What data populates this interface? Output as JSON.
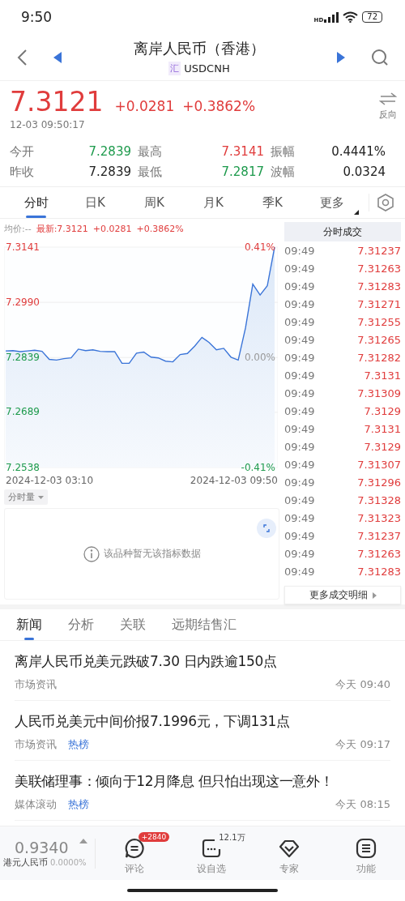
{
  "status_bar": {
    "time": "9:50",
    "battery": "72",
    "signal_tag": "HD"
  },
  "header": {
    "title": "离岸人民币（香港）",
    "badge": "汇",
    "code": "USDCNH"
  },
  "quote": {
    "price": "7.3121",
    "change": "+0.0281",
    "change_pct": "+0.3862%",
    "time": "12-03 09:50:17",
    "swap_label": "反向"
  },
  "stats": [
    {
      "label": "今开",
      "value": "7.2839",
      "color": "#1d9a4c"
    },
    {
      "label": "最高",
      "value": "7.3141",
      "color": "#e03c3c"
    },
    {
      "label": "振幅",
      "value": "0.4441%",
      "color": "#222222"
    },
    {
      "label": "昨收",
      "value": "7.2839",
      "color": "#222222"
    },
    {
      "label": "最低",
      "value": "7.2817",
      "color": "#1d9a4c"
    },
    {
      "label": "波幅",
      "value": "0.0324",
      "color": "#222222"
    }
  ],
  "chart_tabs": [
    {
      "label": "分时",
      "selected": true
    },
    {
      "label": "日K",
      "selected": false
    },
    {
      "label": "周K",
      "selected": false
    },
    {
      "label": "月K",
      "selected": false
    },
    {
      "label": "季K",
      "selected": false
    },
    {
      "label": "更多",
      "selected": false
    }
  ],
  "chart_header": {
    "avg": "均价:--",
    "latest": "最新:7.3121",
    "change": "+0.0281",
    "change_pct": "+0.3862%"
  },
  "chart": {
    "time_labels": [
      "2024-12-03 03:10",
      "2024-12-03 09:50"
    ],
    "percent_labels": [
      "0.41%",
      "0.00%",
      "-0.41%"
    ],
    "chart_data": {
      "type": "area",
      "grid": true,
      "ylim": [
        7.2538,
        7.3141
      ],
      "yticks": [
        {
          "value": 7.3141,
          "label": "7.3141"
        },
        {
          "value": 7.299,
          "label": "7.2990"
        },
        {
          "value": 7.2839,
          "label": "7.2839"
        },
        {
          "value": 7.2689,
          "label": "7.2689"
        },
        {
          "value": 7.2538,
          "label": "7.2538"
        }
      ],
      "series": [
        {
          "color": "#3a74d8",
          "values": [
            7.2857,
            7.2858,
            7.2855,
            7.2857,
            7.2859,
            7.2856,
            7.2834,
            7.2832,
            7.2836,
            7.2838,
            7.2862,
            7.2858,
            7.286,
            7.2856,
            7.2855,
            7.2855,
            7.2823,
            7.2823,
            7.2851,
            7.2854,
            7.284,
            7.2838,
            7.2829,
            7.2827,
            7.2847,
            7.285,
            7.287,
            7.2894,
            7.288,
            7.286,
            7.2864,
            7.284,
            7.2832,
            7.292,
            7.304,
            7.301,
            7.3035,
            7.3141
          ]
        }
      ]
    }
  },
  "indicator": {
    "label": "分时量",
    "empty_text": "该品种暂无该指标数据"
  },
  "trades": {
    "title": "分时成交",
    "rows": [
      {
        "time": "09:49",
        "price": "7.31237"
      },
      {
        "time": "09:49",
        "price": "7.31263"
      },
      {
        "time": "09:49",
        "price": "7.31283"
      },
      {
        "time": "09:49",
        "price": "7.31271"
      },
      {
        "time": "09:49",
        "price": "7.31255"
      },
      {
        "time": "09:49",
        "price": "7.31265"
      },
      {
        "time": "09:49",
        "price": "7.31282"
      },
      {
        "time": "09:49",
        "price": "7.3131"
      },
      {
        "time": "09:49",
        "price": "7.31309"
      },
      {
        "time": "09:49",
        "price": "7.3129"
      },
      {
        "time": "09:49",
        "price": "7.3131"
      },
      {
        "time": "09:49",
        "price": "7.3129"
      },
      {
        "time": "09:49",
        "price": "7.31307"
      },
      {
        "time": "09:49",
        "price": "7.31296"
      },
      {
        "time": "09:49",
        "price": "7.31328"
      },
      {
        "time": "09:49",
        "price": "7.31323"
      },
      {
        "time": "09:49",
        "price": "7.31237"
      },
      {
        "time": "09:49",
        "price": "7.31263"
      },
      {
        "time": "09:49",
        "price": "7.31283"
      }
    ],
    "more": "更多成交明细"
  },
  "news_tabs": [
    {
      "label": "新闻",
      "selected": true
    },
    {
      "label": "分析",
      "selected": false
    },
    {
      "label": "关联",
      "selected": false
    },
    {
      "label": "远期结售汇",
      "selected": false
    }
  ],
  "news": [
    {
      "title": "离岸人民币兑美元跌破7.30 日内跌逾150点",
      "source": "市场资讯",
      "time": "今天 09:40"
    },
    {
      "title": "人民币兑美元中间价报7.1996元，下调131点",
      "source": "市场资讯",
      "tag": "热榜",
      "time": "今天 09:17"
    },
    {
      "title": "美联储理事：倾向于12月降息 但只怕出现这一意外！",
      "source": "媒体滚动",
      "tag": "热榜",
      "time": "今天 08:15"
    }
  ],
  "bottom_bar": {
    "related_price": "0.9340",
    "related_name": "港元人民币",
    "related_pct": "0.0000%",
    "actions": [
      {
        "kind": "comment",
        "label": "评论",
        "badge": "+2840"
      },
      {
        "kind": "watch",
        "label": "设自选",
        "count": "12.1万"
      },
      {
        "kind": "expert",
        "label": "专家"
      },
      {
        "kind": "menu",
        "label": "功能"
      }
    ]
  }
}
